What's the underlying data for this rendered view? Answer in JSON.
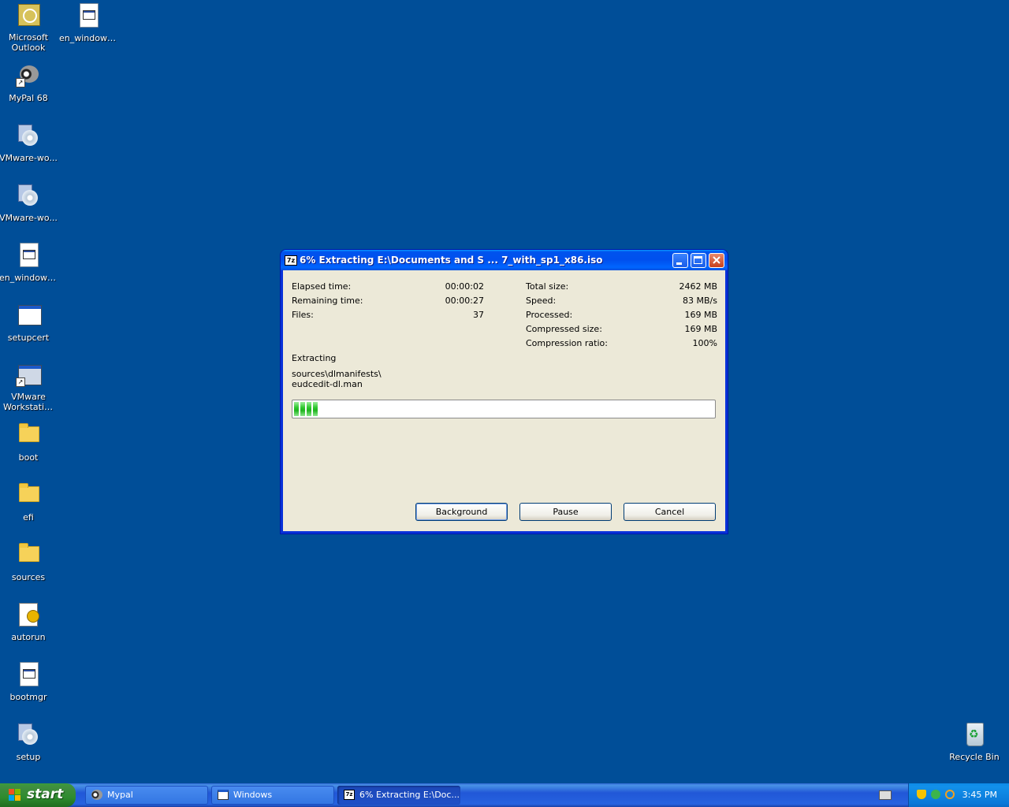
{
  "desktop": {
    "icons": [
      {
        "label": "Microsoft Outlook"
      },
      {
        "label": "en_windows..."
      },
      {
        "label": "MyPal 68"
      },
      {
        "label": "VMware-wo..."
      },
      {
        "label": "VMware-wo..."
      },
      {
        "label": "en_windows..."
      },
      {
        "label": "setupcert"
      },
      {
        "label": "VMware Workstation"
      },
      {
        "label": "boot"
      },
      {
        "label": "efi"
      },
      {
        "label": "sources"
      },
      {
        "label": "autorun"
      },
      {
        "label": "bootmgr"
      },
      {
        "label": "setup"
      },
      {
        "label": "Recycle Bin"
      }
    ]
  },
  "dialog": {
    "title": "6% Extracting E:\\Documents and S ... 7_with_sp1_x86.iso",
    "app_icon_text": "7z",
    "progress_percent": 6,
    "left_stats": [
      {
        "label": "Elapsed time:",
        "value": "00:00:02"
      },
      {
        "label": "Remaining time:",
        "value": "00:00:27"
      },
      {
        "label": "Files:",
        "value": "37"
      }
    ],
    "right_stats": [
      {
        "label": "Total size:",
        "value": "2462 MB"
      },
      {
        "label": "Speed:",
        "value": "83 MB/s"
      },
      {
        "label": "Processed:",
        "value": "169 MB"
      },
      {
        "label": "Compressed size:",
        "value": "169 MB"
      },
      {
        "label": "Compression ratio:",
        "value": "100%"
      }
    ],
    "operation": "Extracting",
    "current_path": "sources\\dlmanifests\\",
    "current_file": "eudcedit-dl.man",
    "buttons": {
      "background": "Background",
      "pause": "Pause",
      "cancel": "Cancel"
    }
  },
  "taskbar": {
    "start_label": "start",
    "tasks": [
      {
        "label": "Mypal"
      },
      {
        "label": "Windows"
      },
      {
        "label": "6% Extracting E:\\Doc..."
      }
    ],
    "clock": "3:45 PM"
  },
  "colors": {
    "desktop": "#004E98",
    "titlebar": "#0053EE",
    "dialog_face": "#ECE9D8",
    "progress": "#2EC72E"
  }
}
